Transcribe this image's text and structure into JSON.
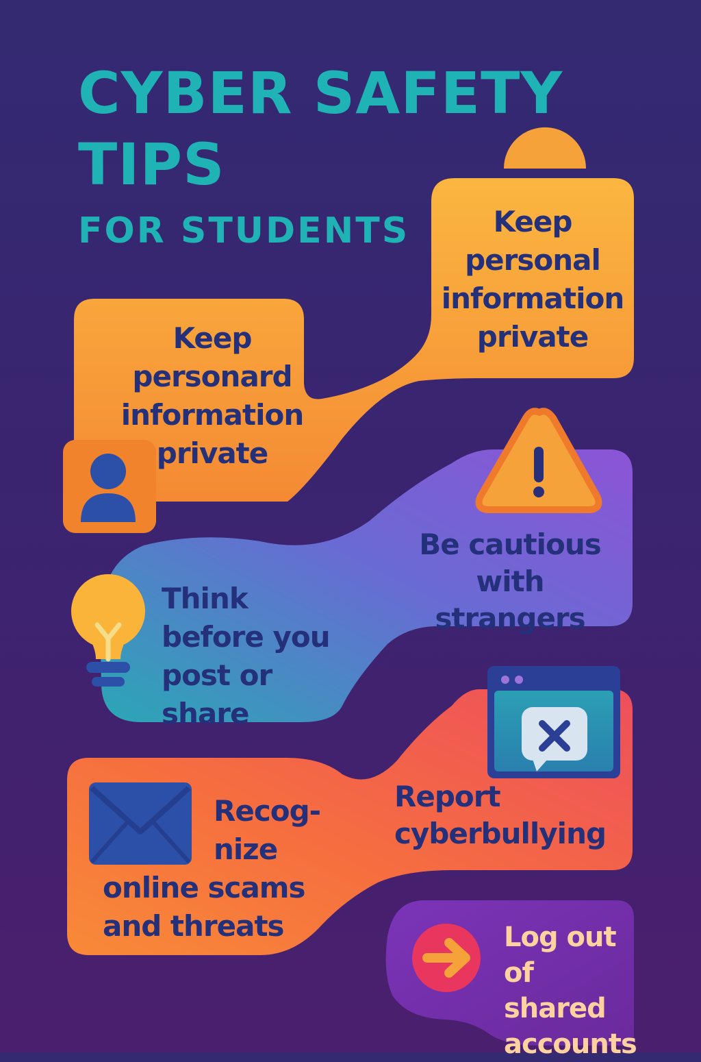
{
  "title": {
    "line1": "CYBER SAFETY",
    "line2": "TIPS",
    "subtitle": "FOR STUDENTS"
  },
  "tips": {
    "tip1": "Keep\npersonal\ninformation\nprivate",
    "tip2": "Keep\npersonard\ninformation\nprivate",
    "tip3": "Be cautious\nwith strangers",
    "tip4": "Think\nbefore you\npost or share",
    "tip5": "Report\ncyberbullying",
    "tip6_top": "Recog-\nnize",
    "tip6_bottom": "online scams\nand threats",
    "tip7": "Log out\nof shared\naccounts"
  },
  "icons": {
    "person": "person-icon",
    "warning": "warning-icon",
    "lightbulb": "lightbulb-icon",
    "report_window": "report-window-icon",
    "envelope": "envelope-icon",
    "arrow": "arrow-right-icon"
  },
  "colors": {
    "background": "#352a72",
    "title": "#1fb3b6",
    "orange": "#f6a23a",
    "purple": "#8a5ad6",
    "teal": "#2aa3b5",
    "coral": "#ef5c5a",
    "magenta": "#7a2ea8",
    "text_dark": "#24307a",
    "text_light": "#ffd2a0"
  }
}
